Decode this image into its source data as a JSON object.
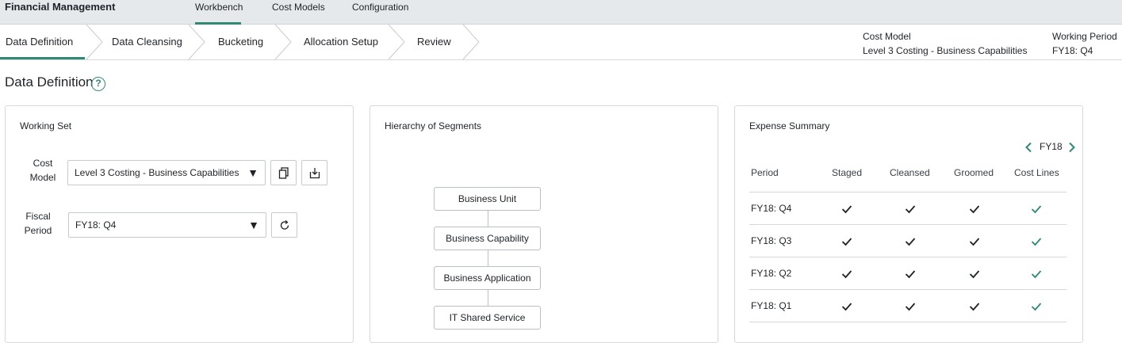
{
  "app": {
    "title": "Financial Management"
  },
  "top_tabs": [
    {
      "label": "Workbench",
      "active": true
    },
    {
      "label": "Cost Models",
      "active": false
    },
    {
      "label": "Configuration",
      "active": false
    }
  ],
  "steps": [
    {
      "label": "Data Definition",
      "active": true
    },
    {
      "label": "Data Cleansing"
    },
    {
      "label": "Bucketing"
    },
    {
      "label": "Allocation Setup"
    },
    {
      "label": "Review"
    }
  ],
  "info": {
    "cost_model_label": "Cost Model",
    "cost_model_value": "Level 3 Costing - Business Capabilities",
    "working_period_label": "Working Period",
    "working_period_value": "FY18: Q4"
  },
  "page": {
    "title": "Data Definition",
    "help_glyph": "?"
  },
  "working_set": {
    "title": "Working Set",
    "cost_model_label_1": "Cost",
    "cost_model_label_2": "Model",
    "cost_model_value": "Level 3 Costing - Business Capabilities",
    "fiscal_label_1": "Fiscal",
    "fiscal_label_2": "Period",
    "fiscal_value": "FY18: Q4",
    "arrow_glyph": "▼"
  },
  "hierarchy": {
    "title": "Hierarchy of Segments",
    "nodes": [
      "Business Unit",
      "Business Capability",
      "Business Application",
      "IT Shared Service"
    ]
  },
  "expense": {
    "title": "Expense Summary",
    "year": "FY18",
    "headers": [
      "Period",
      "Staged",
      "Cleansed",
      "Groomed",
      "Cost Lines"
    ],
    "rows": [
      {
        "period": "FY18: Q4",
        "staged": true,
        "cleansed": true,
        "groomed": true,
        "cost_lines": true
      },
      {
        "period": "FY18: Q3",
        "staged": true,
        "cleansed": true,
        "groomed": true,
        "cost_lines": true
      },
      {
        "period": "FY18: Q2",
        "staged": true,
        "cleansed": true,
        "groomed": true,
        "cost_lines": true
      },
      {
        "period": "FY18: Q1",
        "staged": true,
        "cleansed": true,
        "groomed": true,
        "cost_lines": true
      }
    ]
  },
  "colors": {
    "accent": "#2e8a74",
    "check_dark": "#1f2328"
  }
}
